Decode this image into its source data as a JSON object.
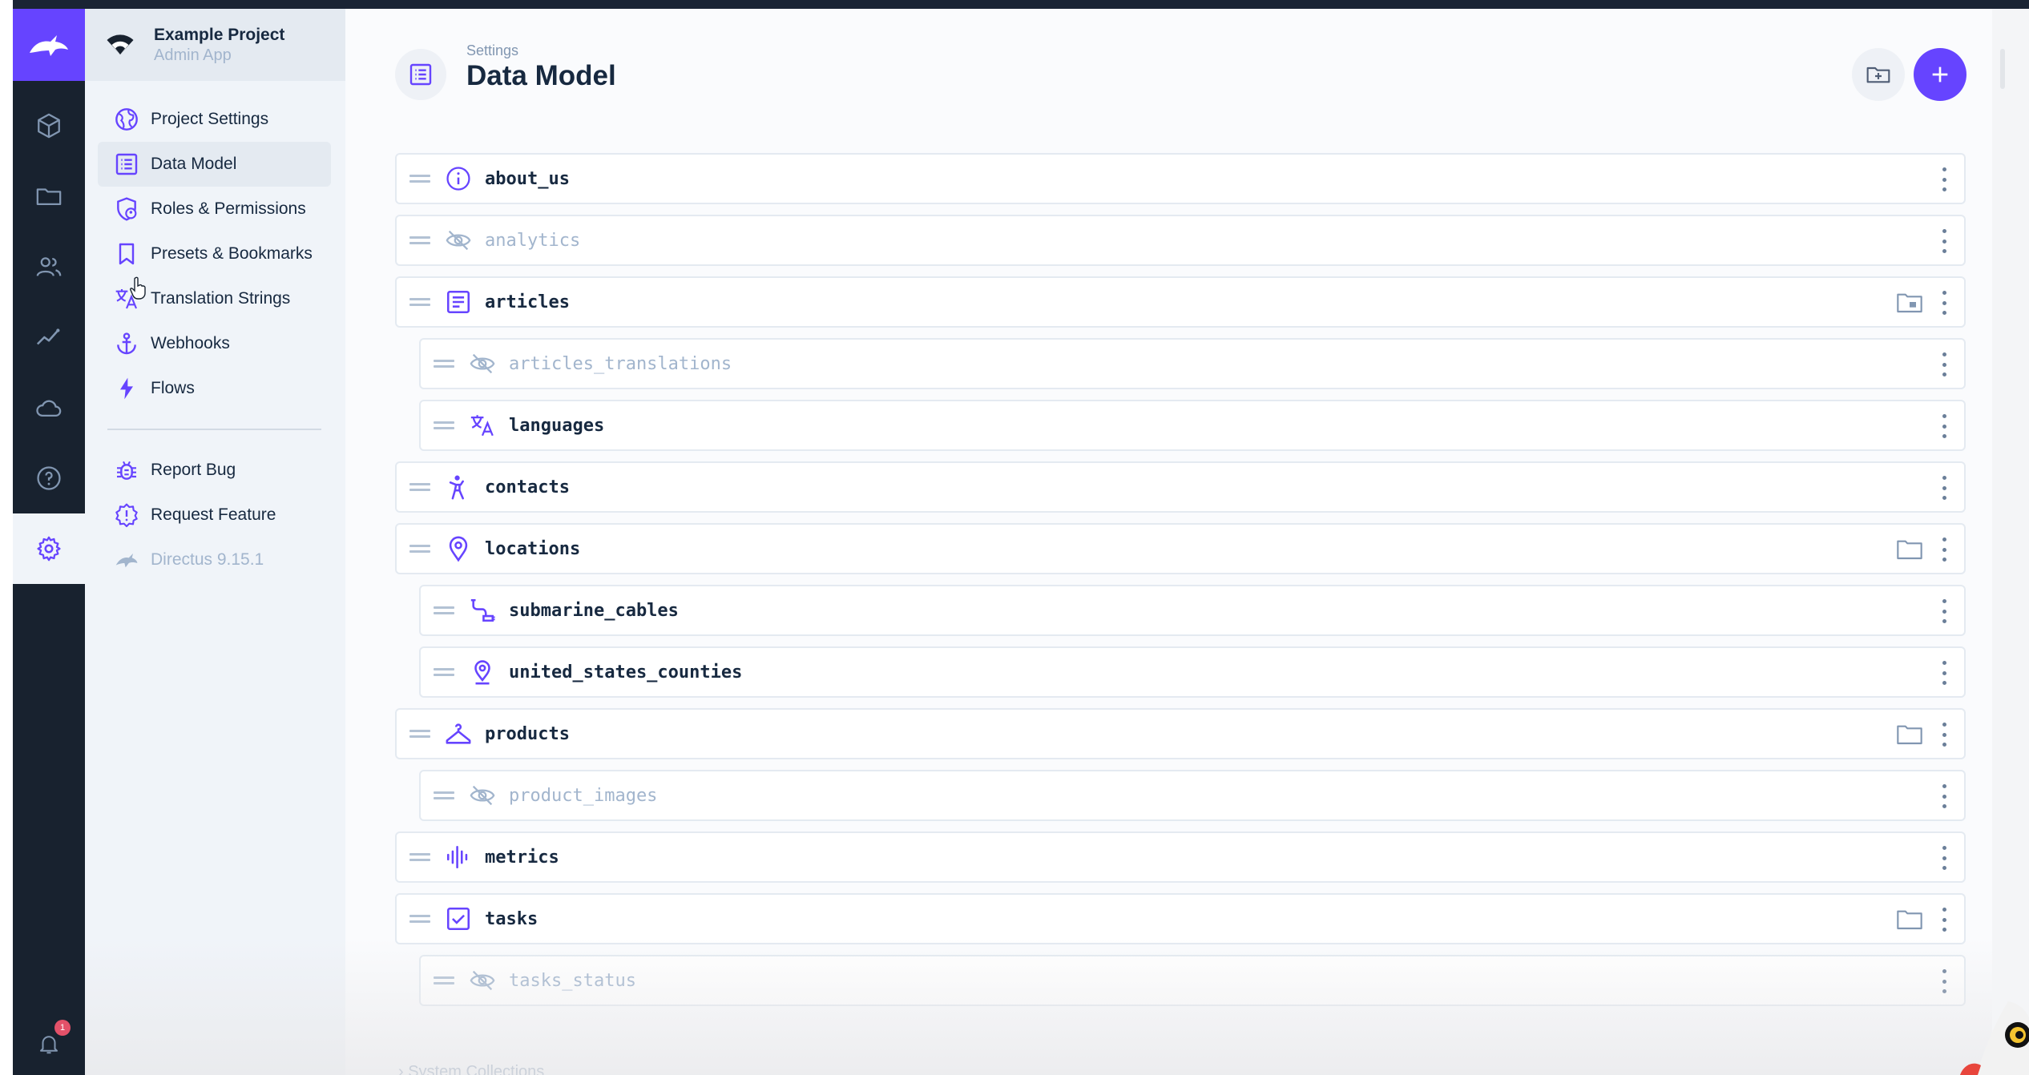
{
  "project": {
    "name": "Example Project",
    "subtitle": "Admin App"
  },
  "modules": [
    {
      "name": "content",
      "icon": "box-icon"
    },
    {
      "name": "files",
      "icon": "folder-icon"
    },
    {
      "name": "users",
      "icon": "users-icon"
    },
    {
      "name": "insights",
      "icon": "insights-icon"
    },
    {
      "name": "cloud",
      "icon": "cloud-icon"
    },
    {
      "name": "help",
      "icon": "help-icon"
    },
    {
      "name": "settings",
      "icon": "gear-icon",
      "active": true
    }
  ],
  "notifications": {
    "count": "1"
  },
  "nav": {
    "items": [
      {
        "label": "Project Settings",
        "icon": "globe-icon"
      },
      {
        "label": "Data Model",
        "icon": "list-alt-icon",
        "active": true
      },
      {
        "label": "Roles & Permissions",
        "icon": "admin-icon"
      },
      {
        "label": "Presets & Bookmarks",
        "icon": "bookmark-icon"
      },
      {
        "label": "Translation Strings",
        "icon": "translate-icon"
      },
      {
        "label": "Webhooks",
        "icon": "anchor-icon"
      },
      {
        "label": "Flows",
        "icon": "bolt-icon"
      }
    ],
    "secondary": [
      {
        "label": "Report Bug",
        "icon": "bug-icon"
      },
      {
        "label": "Request Feature",
        "icon": "new-releases-icon"
      },
      {
        "label": "Directus 9.15.1",
        "icon": "directus-logo-icon",
        "muted": true
      }
    ]
  },
  "header": {
    "breadcrumb": "Settings",
    "title": "Data Model"
  },
  "collections": [
    {
      "name": "about_us",
      "icon": "info-icon"
    },
    {
      "name": "analytics",
      "icon": "visibility-off-icon",
      "hidden": true
    },
    {
      "name": "articles",
      "icon": "article-icon",
      "group": true
    },
    {
      "name": "articles_translations",
      "icon": "visibility-off-icon",
      "hidden": true,
      "nested": true
    },
    {
      "name": "languages",
      "icon": "translate-icon",
      "nested": true
    },
    {
      "name": "contacts",
      "icon": "person-icon"
    },
    {
      "name": "locations",
      "icon": "place-icon",
      "group": true
    },
    {
      "name": "submarine_cables",
      "icon": "cable-icon",
      "nested": true
    },
    {
      "name": "united_states_counties",
      "icon": "place-icon",
      "nested": true
    },
    {
      "name": "products",
      "icon": "hanger-icon",
      "group": true
    },
    {
      "name": "product_images",
      "icon": "visibility-off-icon",
      "hidden": true,
      "nested": true
    },
    {
      "name": "metrics",
      "icon": "graphic-eq-icon"
    },
    {
      "name": "tasks",
      "icon": "check-box-icon",
      "group": true
    },
    {
      "name": "tasks_status",
      "icon": "visibility-off-icon",
      "hidden": true,
      "nested": true
    }
  ],
  "system_collections_label": "System Collections",
  "colors": {
    "primary": "#6644ff",
    "module_bar": "#18222f",
    "nav_bg": "#f0f4f9",
    "text": "#172940",
    "muted": "#a2b5cd"
  }
}
